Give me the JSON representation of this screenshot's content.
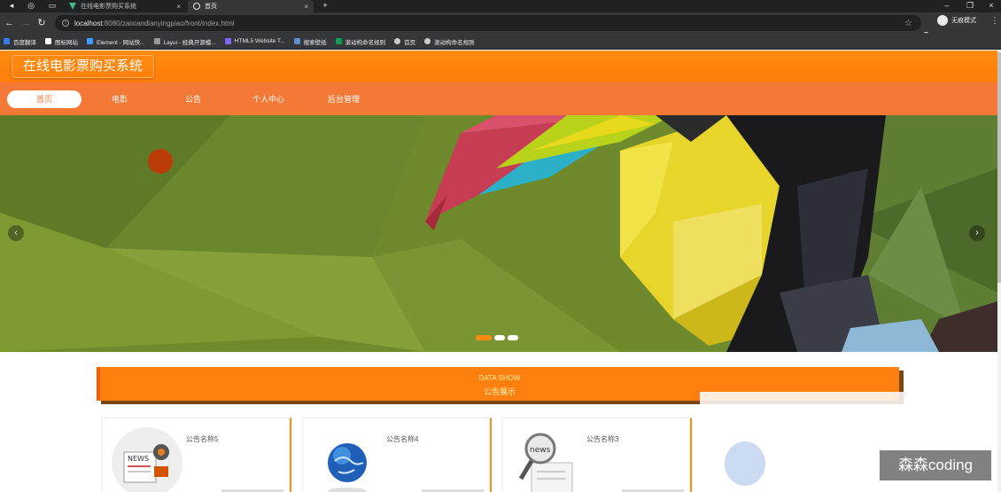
{
  "browser": {
    "tabs": [
      {
        "label": "在线电影票购买系统",
        "close": "×"
      },
      {
        "label": "首页",
        "close": "×"
      }
    ],
    "new_tab": "+",
    "url_host": "localhost",
    "url_path": ":8080/zaixiandianyingpiao/front/index.html",
    "profile_label": "无痕模式",
    "bookmarks": [
      "百度翻译",
      "图标网站",
      "Element - 网站快...",
      "Layui - 经典开源模...",
      "HTML5 Website T...",
      "搜索壁纸",
      "滚动构命名规则",
      "首页",
      "滚动构命名规则"
    ]
  },
  "site": {
    "title": "在线电影票购买系统",
    "nav": [
      "首页",
      "电影",
      "公告",
      "个人中心",
      "后台管理"
    ]
  },
  "section": {
    "title_en": "DATA SHOW",
    "title_cn": "公告展示"
  },
  "cards": [
    {
      "title": "公告名称5",
      "image": "news-gear-icon"
    },
    {
      "title": "公告名称4",
      "image": "globe-icon"
    },
    {
      "title": "公告名称3",
      "image": "news-magnifier-icon"
    }
  ],
  "watermark": "森森coding",
  "colors": {
    "primary": "#ff8c10",
    "nav": "#f47936"
  }
}
